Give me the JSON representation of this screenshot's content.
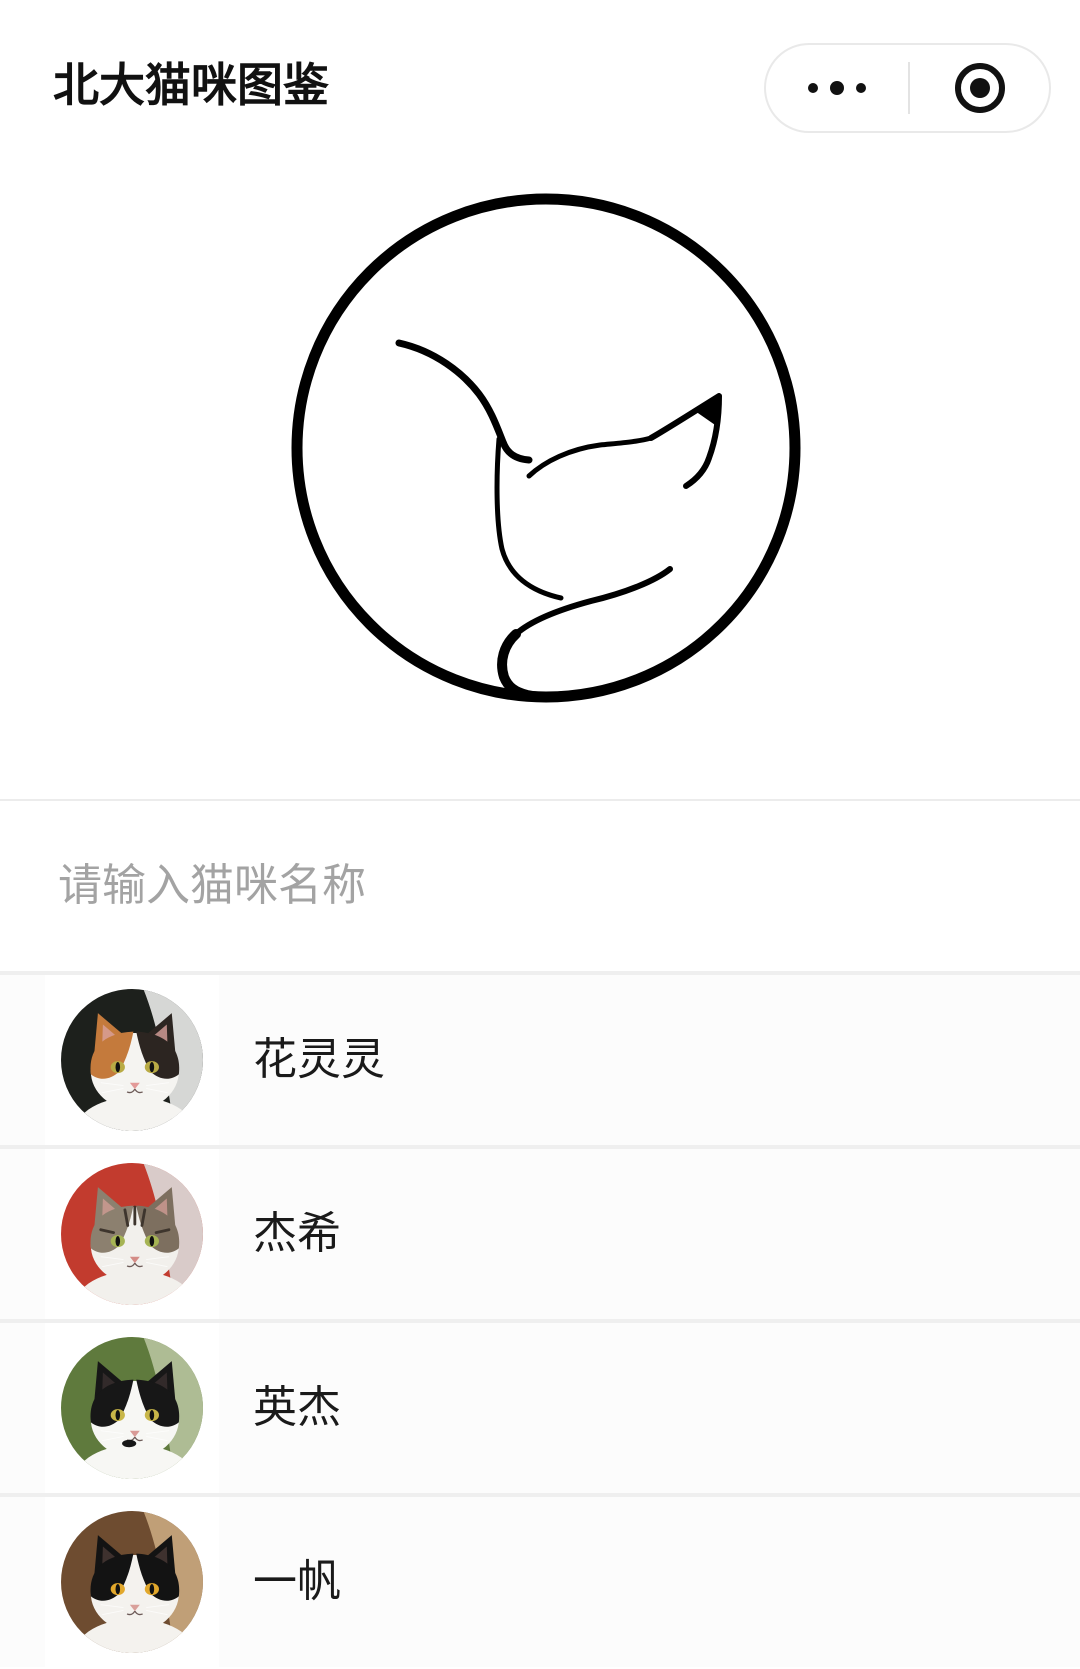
{
  "app": {
    "title": "北大猫咪图鉴"
  },
  "capsule": {
    "menu_icon": "more-dots-icon",
    "close_icon": "target-circle-icon"
  },
  "logo": {
    "icon": "cat-outline-logo"
  },
  "search": {
    "placeholder": "请输入猫咪名称",
    "value": ""
  },
  "cats": [
    {
      "name": "花灵灵",
      "avatar": {
        "bg": "#1d201c",
        "bg_accent": "#ebebea",
        "fur": "#f5f4f1",
        "patch_left": "#c47a3c",
        "patch_right": "#2c2521",
        "ear_inner": "#d9a19c",
        "eye": "#b9ab45",
        "nose": "#e39a98",
        "stripe": null,
        "spot": null
      }
    },
    {
      "name": "杰希",
      "avatar": {
        "bg": "#c23b2e",
        "bg_accent": "#dcdcda",
        "fur": "#f2f0ec",
        "patch_left": "#8c806f",
        "patch_right": "#7d6f5f",
        "ear_inner": "#cf9b93",
        "eye": "#a6b454",
        "nose": "#d48c86",
        "stripe": "#3e352d",
        "spot": null
      }
    },
    {
      "name": "英杰",
      "avatar": {
        "bg": "#5f7a3d",
        "bg_accent": "#b7c39d",
        "fur": "#f7f7f4",
        "patch_left": "#171717",
        "patch_right": "#171717",
        "ear_inner": "#3a3030",
        "eye": "#c8b648",
        "nose": "#d99a96",
        "stripe": null,
        "spot": "#171717"
      }
    },
    {
      "name": "一帆",
      "avatar": {
        "bg": "#6e4c30",
        "bg_accent": "#c9a97f",
        "fur": "#f4f2ee",
        "patch_left": "#131313",
        "patch_right": "#131313",
        "ear_inner": "#4a3a36",
        "eye": "#e2a82c",
        "nose": "#d9a09a",
        "stripe": null,
        "spot": null
      }
    }
  ],
  "colors": {
    "divider": "#efefef",
    "placeholder": "#a3a3a3",
    "name_text": "#1a1a1a",
    "logo_stroke": "#000000"
  }
}
